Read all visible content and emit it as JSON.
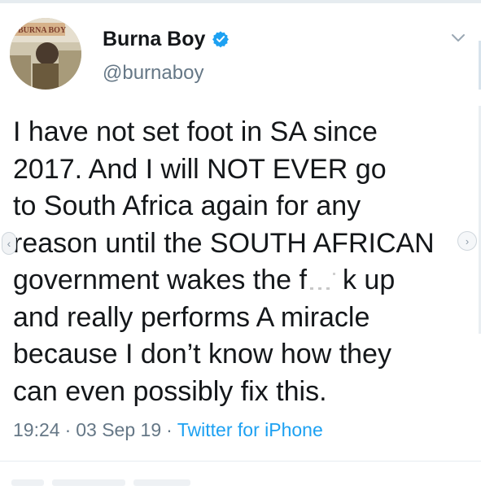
{
  "author": {
    "display_name": "Burna Boy",
    "handle": "@burnaboy",
    "verified": true,
    "avatar_banner_text": "BURNA BOY"
  },
  "tweet": {
    "lines": [
      "I have not set foot in SA since",
      "2017. And I will NOT EVER go",
      "to South Africa again for any",
      "reason until the SOUTH AFRICAN",
      "government wakes the f",
      "and really performs A miracle",
      "because I don’t know how they",
      "can even possibly fix this."
    ],
    "line5_after_redaction": "k up"
  },
  "meta": {
    "time": "19:24",
    "date": "03 Sep 19",
    "separator": "·",
    "source": "Twitter for iPhone"
  },
  "navigation": {
    "left_arrow": "‹",
    "right_arrow": "›"
  },
  "colors": {
    "text": "#14171a",
    "secondary": "#657786",
    "link": "#1da1f2",
    "verified_badge": "#1da1f2"
  },
  "icons": [
    "verified-badge-icon",
    "chevron-down-icon",
    "avatar"
  ]
}
